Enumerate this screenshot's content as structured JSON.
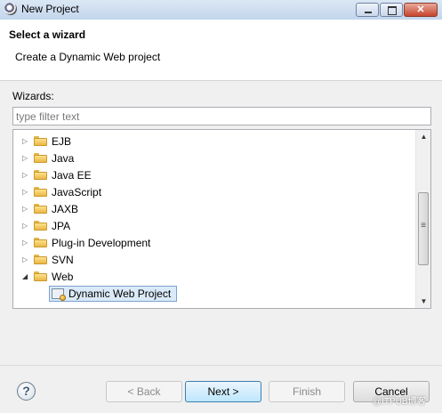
{
  "window": {
    "title": "New Project"
  },
  "banner": {
    "title": "Select a wizard",
    "description": "Create a Dynamic Web project"
  },
  "wizards": {
    "label": "Wizards:",
    "filter_placeholder": "type filter text"
  },
  "tree": {
    "items": [
      {
        "label": "EJB",
        "expanded": false
      },
      {
        "label": "Java",
        "expanded": false
      },
      {
        "label": "Java EE",
        "expanded": false
      },
      {
        "label": "JavaScript",
        "expanded": false
      },
      {
        "label": "JAXB",
        "expanded": false
      },
      {
        "label": "JPA",
        "expanded": false
      },
      {
        "label": "Plug-in Development",
        "expanded": false
      },
      {
        "label": "SVN",
        "expanded": false
      },
      {
        "label": "Web",
        "expanded": true
      }
    ],
    "selected_child": {
      "label": "Dynamic Web Project"
    }
  },
  "buttons": {
    "help": "?",
    "back": "< Back",
    "next": "Next >",
    "finish": "Finish",
    "cancel": "Cancel"
  },
  "watermark": "@ITPUB博客",
  "colors": {
    "selection": "#dbeaf8",
    "selection_border": "#7da2ce",
    "default_button_border": "#3c7fb1"
  },
  "icons": {
    "app": "eclipse-icon",
    "folder": "folder-icon",
    "project": "web-project-icon",
    "help": "help-icon"
  }
}
